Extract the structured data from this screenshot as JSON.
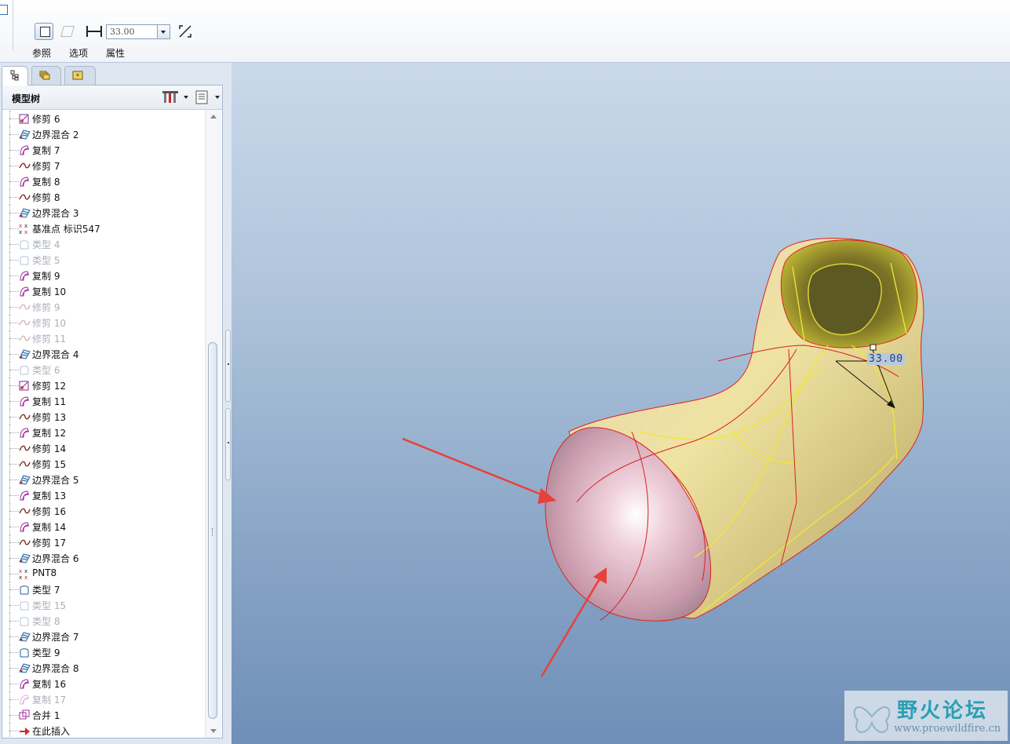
{
  "toolbar": {
    "thickness_value": "33.00",
    "tabs": [
      "参照",
      "选项",
      "属性"
    ]
  },
  "panel": {
    "tree_title": "模型树",
    "tree_items": [
      {
        "label": "修剪 6",
        "type": "trim-patch",
        "suppressed": false
      },
      {
        "label": "边界混合 2",
        "type": "boundary-blend",
        "suppressed": false
      },
      {
        "label": "复制 7",
        "type": "copy",
        "suppressed": false
      },
      {
        "label": "修剪 7",
        "type": "trim-curve",
        "suppressed": false
      },
      {
        "label": "复制 8",
        "type": "copy",
        "suppressed": false
      },
      {
        "label": "修剪 8",
        "type": "trim-curve",
        "suppressed": false
      },
      {
        "label": "边界混合 3",
        "type": "boundary-blend",
        "suppressed": false
      },
      {
        "label": "基准点 标识547",
        "type": "datum-point",
        "suppressed": false
      },
      {
        "label": "类型 4",
        "type": "type-surface",
        "suppressed": true
      },
      {
        "label": "类型 5",
        "type": "type-surface",
        "suppressed": true
      },
      {
        "label": "复制 9",
        "type": "copy",
        "suppressed": false
      },
      {
        "label": "复制 10",
        "type": "copy",
        "suppressed": false
      },
      {
        "label": "修剪 9",
        "type": "trim-curve",
        "suppressed": true
      },
      {
        "label": "修剪 10",
        "type": "trim-curve",
        "suppressed": true
      },
      {
        "label": "修剪 11",
        "type": "trim-curve",
        "suppressed": true
      },
      {
        "label": "边界混合 4",
        "type": "boundary-blend",
        "suppressed": false
      },
      {
        "label": "类型 6",
        "type": "type-surface",
        "suppressed": true
      },
      {
        "label": "修剪 12",
        "type": "trim-patch",
        "suppressed": false
      },
      {
        "label": "复制 11",
        "type": "copy",
        "suppressed": false
      },
      {
        "label": "修剪 13",
        "type": "trim-curve",
        "suppressed": false
      },
      {
        "label": "复制 12",
        "type": "copy",
        "suppressed": false
      },
      {
        "label": "修剪 14",
        "type": "trim-curve",
        "suppressed": false
      },
      {
        "label": "修剪 15",
        "type": "trim-curve",
        "suppressed": false
      },
      {
        "label": "边界混合 5",
        "type": "boundary-blend",
        "suppressed": false
      },
      {
        "label": "复制 13",
        "type": "copy",
        "suppressed": false
      },
      {
        "label": "修剪 16",
        "type": "trim-curve",
        "suppressed": false
      },
      {
        "label": "复制 14",
        "type": "copy",
        "suppressed": false
      },
      {
        "label": "修剪 17",
        "type": "trim-curve",
        "suppressed": false
      },
      {
        "label": "边界混合 6",
        "type": "boundary-blend",
        "suppressed": false
      },
      {
        "label": "PNT8",
        "type": "datum-point",
        "suppressed": false
      },
      {
        "label": "类型 7",
        "type": "type-surface",
        "suppressed": false
      },
      {
        "label": "类型 15",
        "type": "type-surface",
        "suppressed": true
      },
      {
        "label": "类型 8",
        "type": "type-surface",
        "suppressed": true
      },
      {
        "label": "边界混合 7",
        "type": "boundary-blend",
        "suppressed": false
      },
      {
        "label": "类型 9",
        "type": "type-surface",
        "suppressed": false
      },
      {
        "label": "边界混合 8",
        "type": "boundary-blend",
        "suppressed": false
      },
      {
        "label": "复制 16",
        "type": "copy",
        "suppressed": false
      },
      {
        "label": "复制 17",
        "type": "copy",
        "suppressed": true
      },
      {
        "label": "合并 1",
        "type": "merge",
        "suppressed": false
      },
      {
        "label": "在此插入",
        "type": "insert-here",
        "suppressed": false
      }
    ]
  },
  "viewport": {
    "dimension_label": "33.00",
    "watermark_title": "野火论坛",
    "watermark_url": "www.proewildfire.cn"
  },
  "colors": {
    "accent": "#3a6db5",
    "surface_pink": "#d9a8b8",
    "surface_yellow": "#e6e07a",
    "edge_red": "#e02020",
    "arrow_red": "#e8403a"
  }
}
